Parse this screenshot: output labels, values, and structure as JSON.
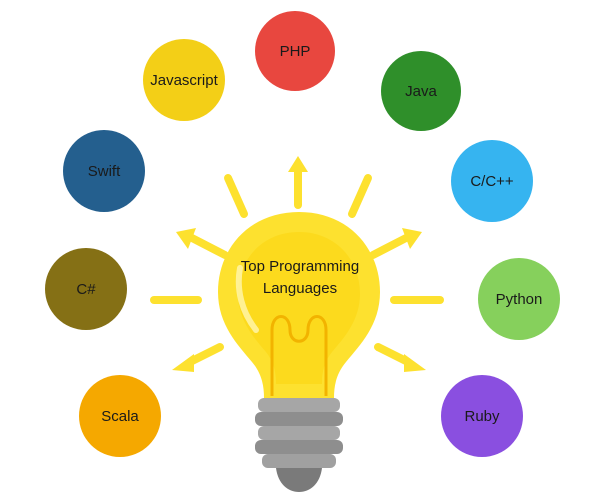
{
  "center": {
    "line1": "Top Programming",
    "line2": "Languages"
  },
  "languages": [
    {
      "label": "PHP",
      "color": "#e8473f"
    },
    {
      "label": "Java",
      "color": "#2f8f2a"
    },
    {
      "label": "C/C++",
      "color": "#36b4f0"
    },
    {
      "label": "Python",
      "color": "#86d05c"
    },
    {
      "label": "Ruby",
      "color": "#8a4fe0"
    },
    {
      "label": "Scala",
      "color": "#f5a800"
    },
    {
      "label": "C#",
      "color": "#857015"
    },
    {
      "label": "Swift",
      "color": "#245f8e"
    },
    {
      "label": "Javascript",
      "color": "#f3cf17"
    }
  ],
  "colors": {
    "bulb": "#fde12f",
    "bulb_inner": "#f7c600",
    "filament": "#f2b300",
    "base": "#9c9c9c",
    "rays": "#fde12f"
  }
}
